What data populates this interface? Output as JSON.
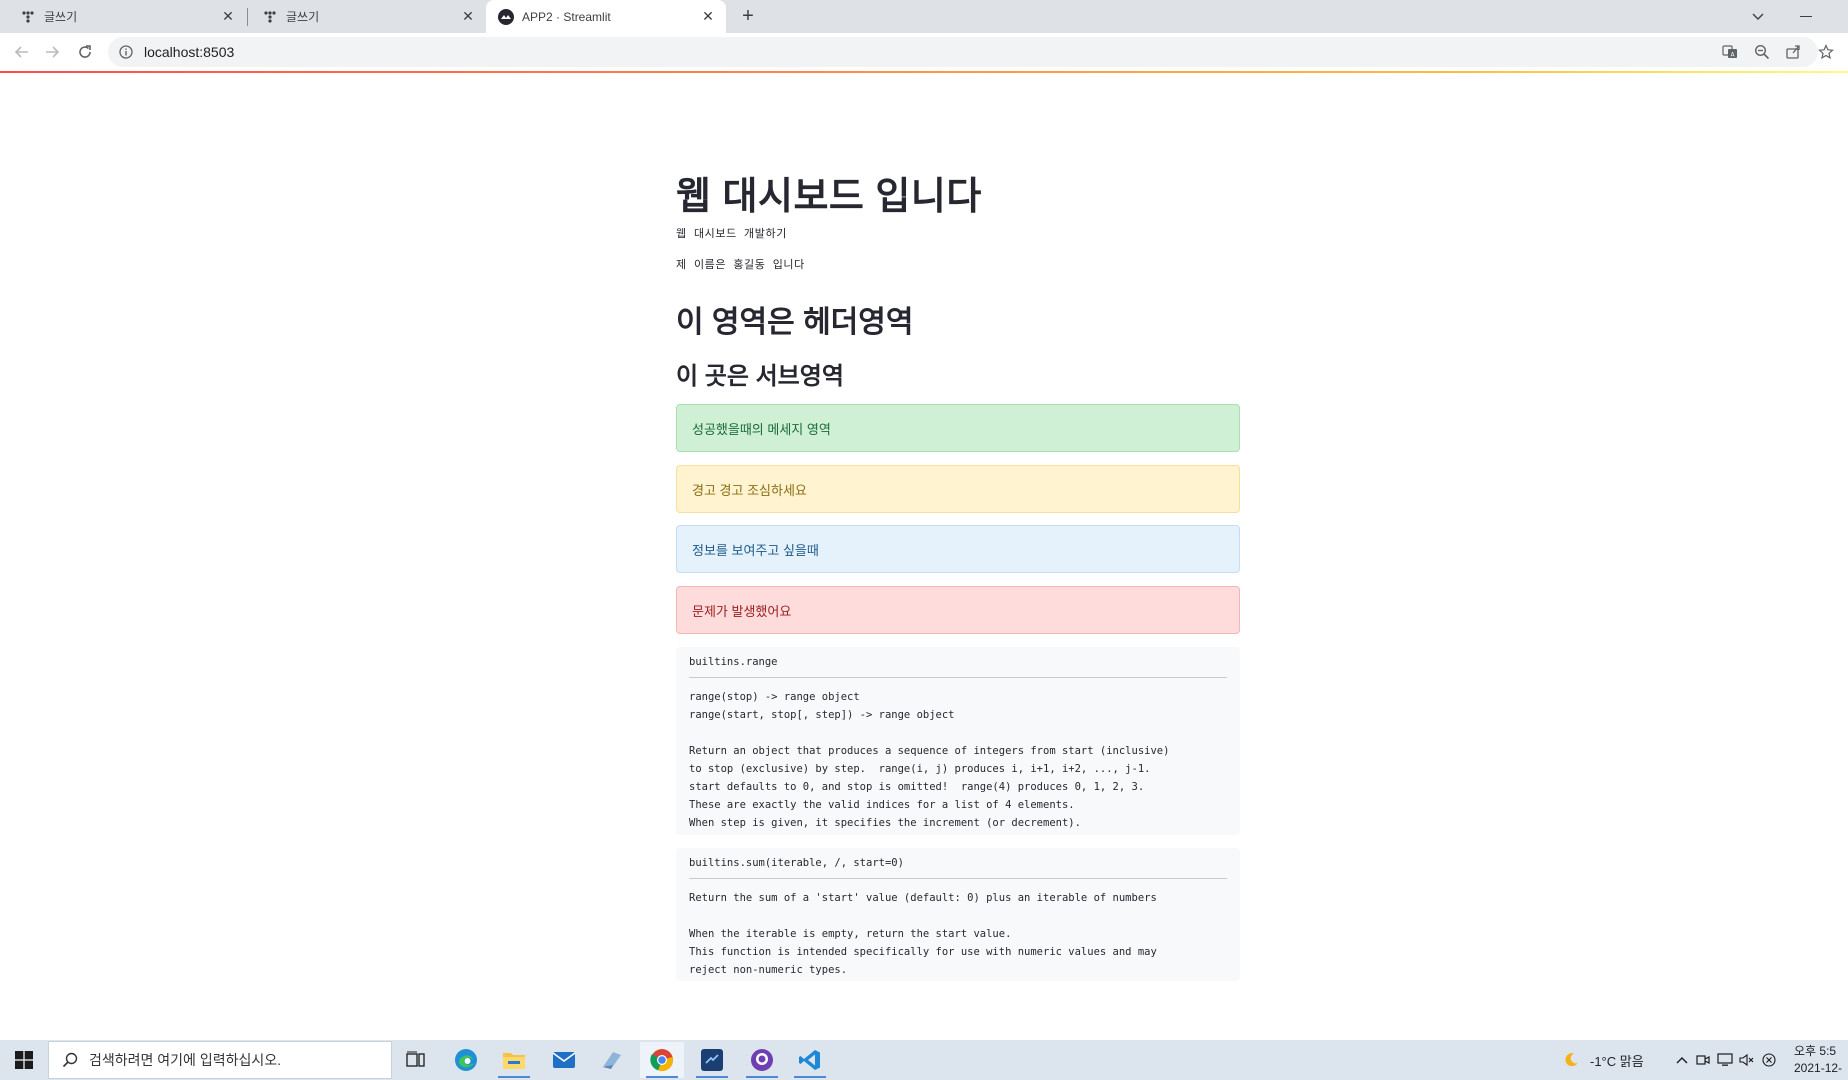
{
  "browser": {
    "tabs": [
      {
        "title": "글쓰기",
        "icon": "glitch-icon"
      },
      {
        "title": "글쓰기",
        "icon": "glitch-icon"
      },
      {
        "title": "APP2 · Streamlit",
        "icon": "streamlit-icon"
      }
    ],
    "new_tab_label": "+",
    "url": "localhost:8503"
  },
  "page": {
    "title": "웹 대시보드 입니다",
    "text_lines": [
      "웹 대시보드 개발하기",
      "제 이름은 홍길동 입니다"
    ],
    "header": "이 영역은 헤더영역",
    "subheader": "이 곳은 서브영역",
    "alerts": {
      "success": "성공했을때의 메세지 영역",
      "warning": "경고 경고 조심하세요",
      "info": "정보를 보여주고 싶을때",
      "error": "문제가 발생했어요"
    },
    "help_blocks": [
      {
        "name": "builtins.range",
        "doc": "range(stop) -> range object\nrange(start, stop[, step]) -> range object\n\nReturn an object that produces a sequence of integers from start (inclusive)\nto stop (exclusive) by step.  range(i, j) produces i, i+1, i+2, ..., j-1.\nstart defaults to 0, and stop is omitted!  range(4) produces 0, 1, 2, 3.\nThese are exactly the valid indices for a list of 4 elements.\nWhen step is given, it specifies the increment (or decrement)."
      },
      {
        "name": "builtins.sum(iterable, /, start=0)",
        "doc": "Return the sum of a 'start' value (default: 0) plus an iterable of numbers\n\nWhen the iterable is empty, return the start value.\nThis function is intended specifically for use with numeric values and may\nreject non-numeric types."
      }
    ]
  },
  "taskbar": {
    "search_placeholder": "검색하려면 여기에 입력하십시오.",
    "apps": [
      "task-view-icon",
      "edge-icon",
      "file-explorer-icon",
      "mail-icon",
      "notepad-icon",
      "chrome-icon",
      "vscode-blue-icon",
      "github-desktop-icon",
      "vscode-icon"
    ],
    "weather": "-1°C  맑음",
    "clock_time": "오후 5:5",
    "clock_date": "2021-12-"
  },
  "colors": {
    "streamlit_red": "#ff4b4b",
    "success_bg": "#d0f0d6",
    "warning_bg": "#fff4cf",
    "info_bg": "#e6f2fb",
    "error_bg": "#ffdcdc"
  }
}
